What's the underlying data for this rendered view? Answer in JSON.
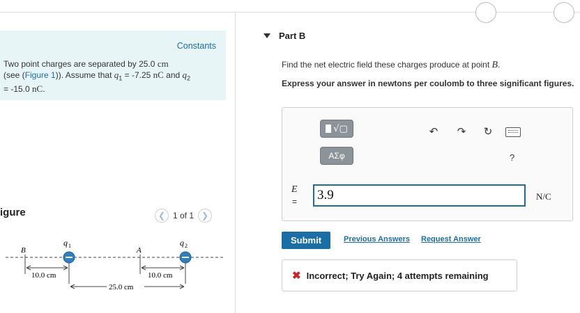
{
  "intro": {
    "constants_link": "Constants",
    "line1": "Two point charges are separated by 25.0 ",
    "unit_cm": "cm",
    "line2_pre": "(see (",
    "figure_link": "Figure 1",
    "line2_post": ")). Assume that ",
    "q1": "q",
    "q1_sub": "1",
    "q1_val": " = -7.25 ",
    "unit_nc": "nC",
    "and_q2": " and ",
    "q2": "q",
    "q2_sub": "2",
    "q2_val": "= -15.0 ",
    "end": "."
  },
  "figure_panel": {
    "title": "igure",
    "page": "1 of 1",
    "labels": {
      "q1": "q",
      "q1_sub": "1",
      "q2": "q",
      "q2_sub": "2",
      "B": "B",
      "A": "A",
      "d1": "10.0 cm",
      "d2": "10.0 cm",
      "d3": "25.0 cm"
    }
  },
  "part": {
    "label": "Part B",
    "question_pre": "Find the net electric field these charges produce at point ",
    "question_var": "B",
    "question_post": ".",
    "instruction": "Express your answer in newtons per coulomb to three significant figures."
  },
  "answer": {
    "toolbar_greek": "ΑΣφ",
    "help": "?",
    "var": "E",
    "eq": "=",
    "value": "3.9",
    "unit": "N/C"
  },
  "actions": {
    "submit": "Submit",
    "previous": "Previous Answers",
    "request": "Request Answer"
  },
  "feedback": {
    "text": "Incorrect; Try Again; 4 attempts remaining"
  },
  "colors": {
    "accent": "#1a6ea8",
    "intro_bg": "#e8f5f7",
    "error": "#cc2222",
    "charge": "#2f7fc4"
  }
}
